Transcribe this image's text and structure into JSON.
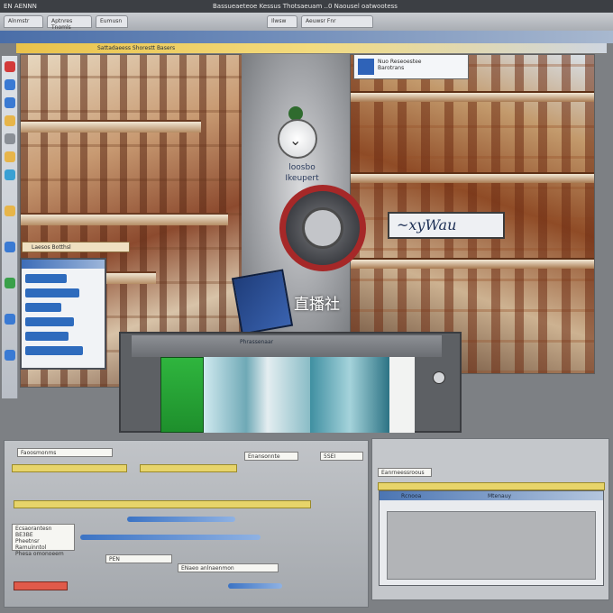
{
  "menubar": {
    "left_text": "EN  AENNN",
    "center_text": "Bassueaeteoe Kessus Thotsaeuam ..0 Naousel oatwootess"
  },
  "tabs": [
    "Alnmstr",
    "Aptnres Tnomls",
    "Eumusn",
    "Ilwsw",
    "Aeuwsr Fnr"
  ],
  "header": {
    "ribbon_text": "Sattadaeess Shorestt Basers"
  },
  "scene": {
    "sign_text": "~xyWau",
    "info_card_title": "Nuo Reseoestee",
    "info_card_sub": "Barotrans"
  },
  "center": {
    "label_top": "loosbo",
    "label_bottom": "Ikeupert",
    "banner_text": "直播社"
  },
  "lobby": {
    "tag": "Laesos Botthsl"
  },
  "player": {
    "title": "Phrassenaar"
  },
  "lower_left": {
    "field_1": "Faoosmonms",
    "field_2": "Enansonnte",
    "value_box": "5SEI",
    "notes": "Ecsaorantesn BE3BE\nPheetnsr Ramuinntol\nPhesa omonoeem",
    "pen_field": "PEN",
    "status": "ENaeo anlnaenmon"
  },
  "lower_right": {
    "title": "Eanrneessroous",
    "dialog_title": "Rcnooa",
    "dialog_right": "Mtenauy"
  },
  "colors": {
    "accent_blue": "#3d6db8",
    "accent_red": "#a62828",
    "accent_green": "#2fb53e",
    "accent_yellow": "#e7d46a"
  }
}
